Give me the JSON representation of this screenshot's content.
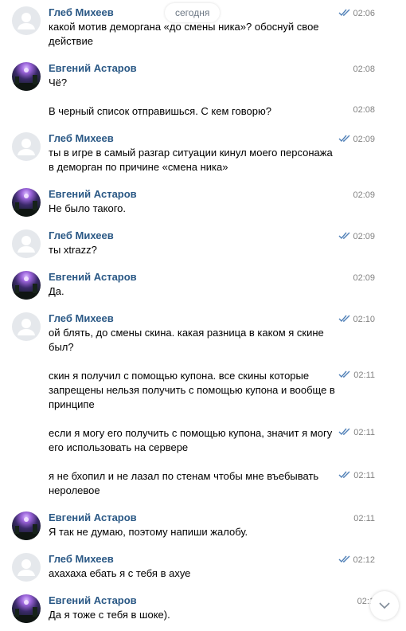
{
  "date_divider": "сегодня",
  "messages": [
    {
      "author": "Глеб Михеев",
      "avatar": "default-avatar",
      "text": "какой мотив деморгана «до смены ника»? обоснуй свое действие",
      "time": "02:06",
      "read": true
    },
    {
      "author": "Евгений Астаров",
      "avatar": "photo-avatar",
      "text": "Чё?",
      "time": "02:08",
      "read": false
    },
    {
      "author": "",
      "avatar": "",
      "text": "В черный список отправишься. С кем говорю?",
      "time": "02:08",
      "read": false
    },
    {
      "author": "Глеб Михеев",
      "avatar": "default-avatar",
      "text": "ты в игре в самый разгар ситуации кинул моего персонажа в деморган по причине «смена ника»",
      "time": "02:09",
      "read": true
    },
    {
      "author": "Евгений Астаров",
      "avatar": "photo-avatar",
      "text": "Не было такого.",
      "time": "02:09",
      "read": false
    },
    {
      "author": "Глеб Михеев",
      "avatar": "default-avatar",
      "text": "ты xtrazz?",
      "time": "02:09",
      "read": true
    },
    {
      "author": "Евгений Астаров",
      "avatar": "photo-avatar",
      "text": "Да.",
      "time": "02:09",
      "read": false
    },
    {
      "author": "Глеб Михеев",
      "avatar": "default-avatar",
      "text": "ой блять, до смены скина. какая разница в каком я скине был?",
      "time": "02:10",
      "read": true
    },
    {
      "author": "",
      "avatar": "",
      "text": "скин я получил с помощью купона. все скины которые запрещены нельзя получить с помощью купона и вообще в принципе",
      "time": "02:11",
      "read": true
    },
    {
      "author": "",
      "avatar": "",
      "text": "если я могу его получить с помощью купона, значит я могу его использовать на сервере",
      "time": "02:11",
      "read": true
    },
    {
      "author": "",
      "avatar": "",
      "text": "я не бхопил и не лазал по стенам чтобы мне въебывать неролевое",
      "time": "02:11",
      "read": true
    },
    {
      "author": "Евгений Астаров",
      "avatar": "photo-avatar",
      "text": "Я так не думаю, поэтому напиши жалобу.",
      "time": "02:11",
      "read": false
    },
    {
      "author": "Глеб Михеев",
      "avatar": "default-avatar",
      "text": "ахахаха ебать я с тебя в ахуе",
      "time": "02:12",
      "read": true
    },
    {
      "author": "Евгений Астаров",
      "avatar": "photo-avatar",
      "text": "Да я тоже с тебя в шоке).",
      "time": "02:1",
      "read": false
    }
  ],
  "scroll_button": "chevron-down-icon",
  "colors": {
    "name": "#2a5885",
    "time": "#828282",
    "ticks": "#5181b8"
  }
}
